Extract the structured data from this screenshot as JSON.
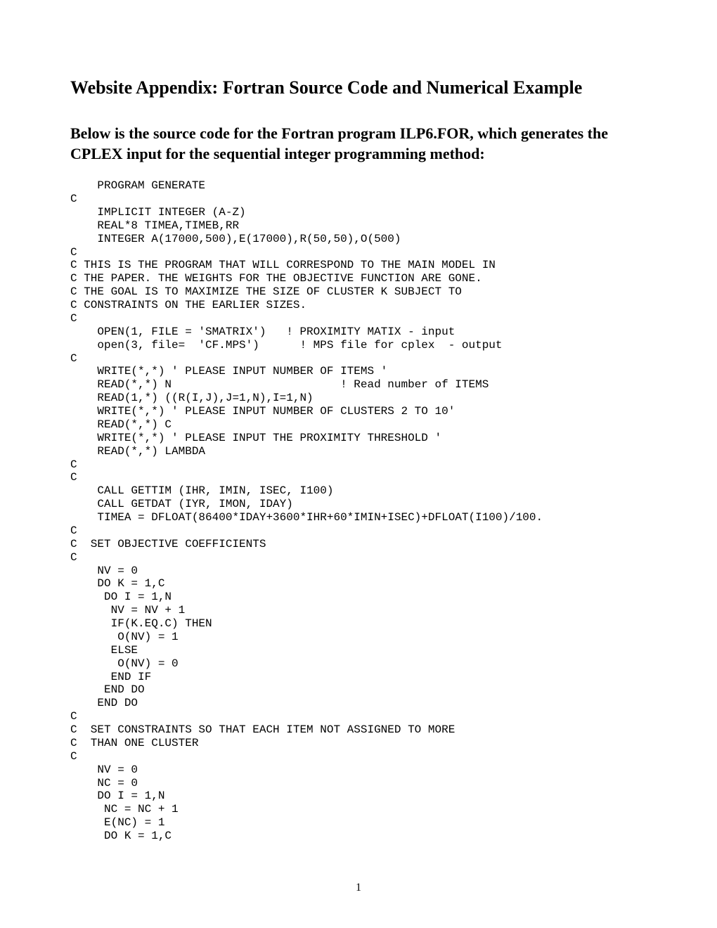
{
  "title": "Website Appendix: Fortran Source Code and Numerical Example",
  "subtitle": "Below is the source code for the Fortran program ILP6.FOR, which generates the CPLEX input for the sequential integer programming method:",
  "code": "    PROGRAM GENERATE\nC\n    IMPLICIT INTEGER (A-Z)\n    REAL*8 TIMEA,TIMEB,RR\n    INTEGER A(17000,500),E(17000),R(50,50),O(500)\nC\nC THIS IS THE PROGRAM THAT WILL CORRESPOND TO THE MAIN MODEL IN\nC THE PAPER. THE WEIGHTS FOR THE OBJECTIVE FUNCTION ARE GONE.\nC THE GOAL IS TO MAXIMIZE THE SIZE OF CLUSTER K SUBJECT TO\nC CONSTRAINTS ON THE EARLIER SIZES.\nC\n    OPEN(1, FILE = 'SMATRIX')   ! PROXIMITY MATIX - input\n    open(3, file=  'CF.MPS')      ! MPS file for cplex  - output\nC\n    WRITE(*,*) ' PLEASE INPUT NUMBER OF ITEMS '\n    READ(*,*) N                         ! Read number of ITEMS\n    READ(1,*) ((R(I,J),J=1,N),I=1,N)\n    WRITE(*,*) ' PLEASE INPUT NUMBER OF CLUSTERS 2 TO 10'\n    READ(*,*) C\n    WRITE(*,*) ' PLEASE INPUT THE PROXIMITY THRESHOLD '\n    READ(*,*) LAMBDA\nC\nC\n    CALL GETTIM (IHR, IMIN, ISEC, I100)\n    CALL GETDAT (IYR, IMON, IDAY)\n    TIMEA = DFLOAT(86400*IDAY+3600*IHR+60*IMIN+ISEC)+DFLOAT(I100)/100.\nC\nC  SET OBJECTIVE COEFFICIENTS\nC\n    NV = 0\n    DO K = 1,C\n     DO I = 1,N\n      NV = NV + 1\n      IF(K.EQ.C) THEN\n       O(NV) = 1\n      ELSE\n       O(NV) = 0\n      END IF\n     END DO\n    END DO\nC\nC  SET CONSTRAINTS SO THAT EACH ITEM NOT ASSIGNED TO MORE\nC  THAN ONE CLUSTER\nC\n    NV = 0\n    NC = 0\n    DO I = 1,N\n     NC = NC + 1\n     E(NC) = 1\n     DO K = 1,C",
  "pageNumber": "1"
}
